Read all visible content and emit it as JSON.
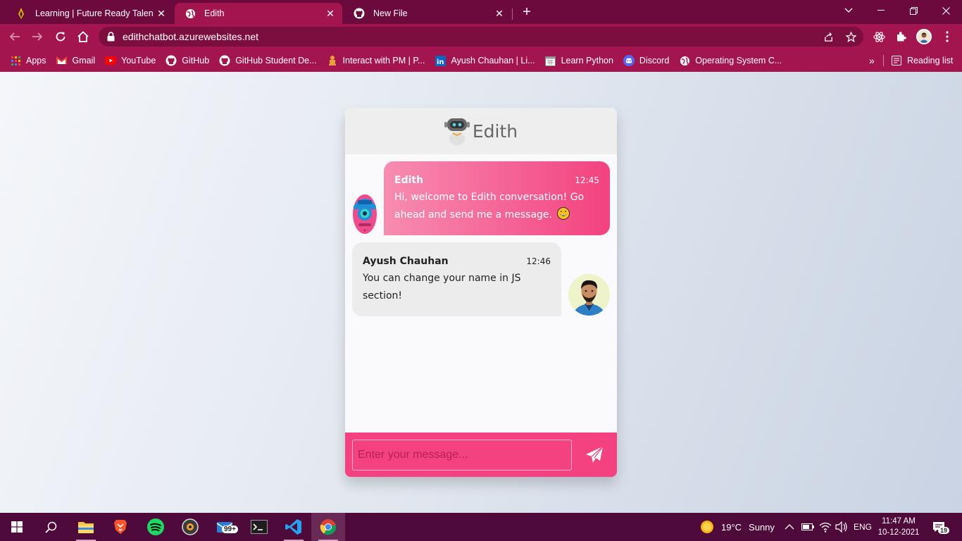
{
  "browser": {
    "tabs": [
      {
        "title": "Learning | Future Ready Talent",
        "icon": "flame-icon"
      },
      {
        "title": "Edith",
        "icon": "globe-icon",
        "active": true
      },
      {
        "title": "New File",
        "icon": "github-icon"
      }
    ],
    "url": "edithchatbot.azurewebsites.net",
    "bookmarks": [
      {
        "label": "Apps",
        "icon": "apps-grid-icon"
      },
      {
        "label": "Gmail",
        "icon": "gmail-icon"
      },
      {
        "label": "YouTube",
        "icon": "youtube-icon"
      },
      {
        "label": "GitHub",
        "icon": "github-icon"
      },
      {
        "label": "GitHub Student De...",
        "icon": "github-icon"
      },
      {
        "label": "Interact with PM | P...",
        "icon": "indian-emblem-icon"
      },
      {
        "label": "Ayush Chauhan | Li...",
        "icon": "linkedin-icon"
      },
      {
        "label": "Learn Python",
        "icon": "calendar-icon"
      },
      {
        "label": "Discord",
        "icon": "discord-icon"
      },
      {
        "label": "Operating System C...",
        "icon": "globe-icon"
      }
    ],
    "bookmarks_more": "»",
    "reading_list": "Reading list"
  },
  "chat": {
    "title": "Edith",
    "messages": [
      {
        "sender": "Edith",
        "time": "12:45",
        "text": "Hi, welcome to Edith conversation! Go ahead and send me a message.",
        "side": "left"
      },
      {
        "sender": "Ayush Chauhan",
        "time": "12:46",
        "text": "You can change your name in JS section!",
        "side": "right"
      }
    ],
    "input_placeholder": "Enter your message...",
    "colors": {
      "accent": "#f3427f",
      "header": "#eeeeee"
    }
  },
  "taskbar": {
    "mail_badge": "99+",
    "weather_temp": "19°C",
    "weather_text": "Sunny",
    "language": "ENG",
    "time": "11:47 AM",
    "date": "10-12-2021",
    "notification_count": "19"
  }
}
